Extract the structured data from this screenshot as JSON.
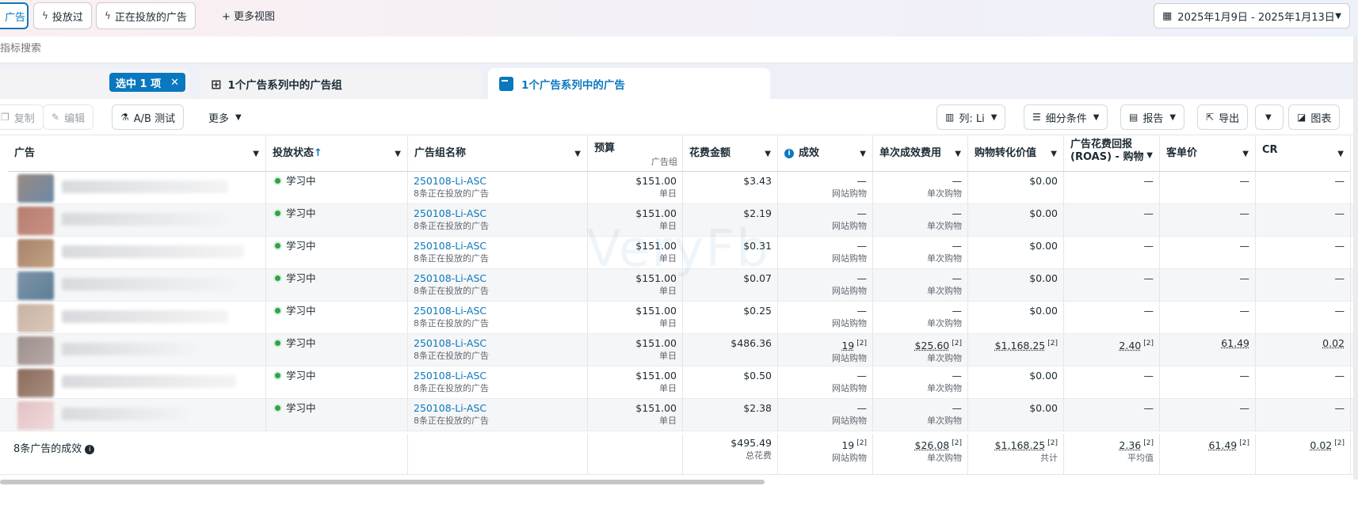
{
  "header": {
    "chips": [
      {
        "label": "广告",
        "icon": "ad-icon",
        "active": true
      },
      {
        "label": "投放过",
        "icon": "lightning-icon",
        "active": false
      },
      {
        "label": "正在投放的广告",
        "icon": "lightning-icon",
        "active": false
      }
    ],
    "more_views_label": "+ 更多视图",
    "date_range": "2025年1月9日 - 2025年1月13日"
  },
  "search": {
    "placeholder": "指标搜索"
  },
  "tabs": {
    "selected_badge": "选中 1 项",
    "adsets_tab": "1个广告系列中的广告组",
    "ads_tab": "1个广告系列中的广告"
  },
  "toolbar": {
    "copy": "复制",
    "edit": "编辑",
    "ab_test": "A/B 测试",
    "more": "更多",
    "columns": "列: Li",
    "breakdown": "细分条件",
    "report": "报告",
    "export": "导出",
    "chart": "图表"
  },
  "table": {
    "headers": {
      "ad": "广告",
      "status": "投放状态",
      "adset_name": "广告组名称",
      "budget": "预算",
      "budget_sub": "广告组",
      "spend": "花费金额",
      "results": "成效",
      "cost_per_result": "单次成效费用",
      "purchase_value": "购物转化价值",
      "roas_line1": "广告花费回报",
      "roas_line2": "(ROAS) - 购物",
      "aov": "客单价",
      "cr": "CR"
    },
    "rows": [
      {
        "status": "学习中",
        "adset": "250108-Li-ASC",
        "adset_sub": "8条正在投放的广告",
        "budget": "$151.00",
        "budget_sub": "单日",
        "spend": "$3.43",
        "results": "—",
        "results_sub": "网站购物",
        "cpr": "—",
        "cpr_sub": "单次购物",
        "value": "$0.00",
        "roas": "—",
        "aov": "—",
        "cr": "—"
      },
      {
        "status": "学习中",
        "adset": "250108-Li-ASC",
        "adset_sub": "8条正在投放的广告",
        "budget": "$151.00",
        "budget_sub": "单日",
        "spend": "$2.19",
        "results": "—",
        "results_sub": "网站购物",
        "cpr": "—",
        "cpr_sub": "单次购物",
        "value": "$0.00",
        "roas": "—",
        "aov": "—",
        "cr": "—"
      },
      {
        "status": "学习中",
        "adset": "250108-Li-ASC",
        "adset_sub": "8条正在投放的广告",
        "budget": "$151.00",
        "budget_sub": "单日",
        "spend": "$0.31",
        "results": "—",
        "results_sub": "网站购物",
        "cpr": "—",
        "cpr_sub": "单次购物",
        "value": "$0.00",
        "roas": "—",
        "aov": "—",
        "cr": "—"
      },
      {
        "status": "学习中",
        "adset": "250108-Li-ASC",
        "adset_sub": "8条正在投放的广告",
        "budget": "$151.00",
        "budget_sub": "单日",
        "spend": "$0.07",
        "results": "—",
        "results_sub": "网站购物",
        "cpr": "—",
        "cpr_sub": "单次购物",
        "value": "$0.00",
        "roas": "—",
        "aov": "—",
        "cr": "—"
      },
      {
        "status": "学习中",
        "adset": "250108-Li-ASC",
        "adset_sub": "8条正在投放的广告",
        "budget": "$151.00",
        "budget_sub": "单日",
        "spend": "$0.25",
        "results": "—",
        "results_sub": "网站购物",
        "cpr": "—",
        "cpr_sub": "单次购物",
        "value": "$0.00",
        "roas": "—",
        "aov": "—",
        "cr": "—"
      },
      {
        "status": "学习中",
        "adset": "250108-Li-ASC",
        "adset_sub": "8条正在投放的广告",
        "budget": "$151.00",
        "budget_sub": "单日",
        "spend": "$486.36",
        "results": "19",
        "results_sub": "网站购物",
        "cpr": "$25.60",
        "cpr_sub": "单次购物",
        "value": "$1,168.25",
        "roas": "2.40",
        "aov": "61.49",
        "cr": "0.02"
      },
      {
        "status": "学习中",
        "adset": "250108-Li-ASC",
        "adset_sub": "8条正在投放的广告",
        "budget": "$151.00",
        "budget_sub": "单日",
        "spend": "$0.50",
        "results": "—",
        "results_sub": "网站购物",
        "cpr": "—",
        "cpr_sub": "单次购物",
        "value": "$0.00",
        "roas": "—",
        "aov": "—",
        "cr": "—"
      },
      {
        "status": "学习中",
        "adset": "250108-Li-ASC",
        "adset_sub": "8条正在投放的广告",
        "budget": "$151.00",
        "budget_sub": "单日",
        "spend": "$2.38",
        "results": "—",
        "results_sub": "网站购物",
        "cpr": "—",
        "cpr_sub": "单次购物",
        "value": "$0.00",
        "roas": "—",
        "aov": "—",
        "cr": "—"
      }
    ],
    "totals": {
      "label": "8条广告的成效",
      "spend": "$495.49",
      "spend_sub": "总花费",
      "results": "19",
      "results_sub": "网站购物",
      "cpr": "$26.08",
      "cpr_sub": "单次购物",
      "value": "$1,168.25",
      "value_sub": "共计",
      "roas": "2.36",
      "roas_sub": "平均值",
      "aov": "61.49",
      "cr": "0.02"
    }
  },
  "watermark": "VeryFb",
  "colors": {
    "accent": "#0a78be",
    "learning": "#31a24c"
  }
}
